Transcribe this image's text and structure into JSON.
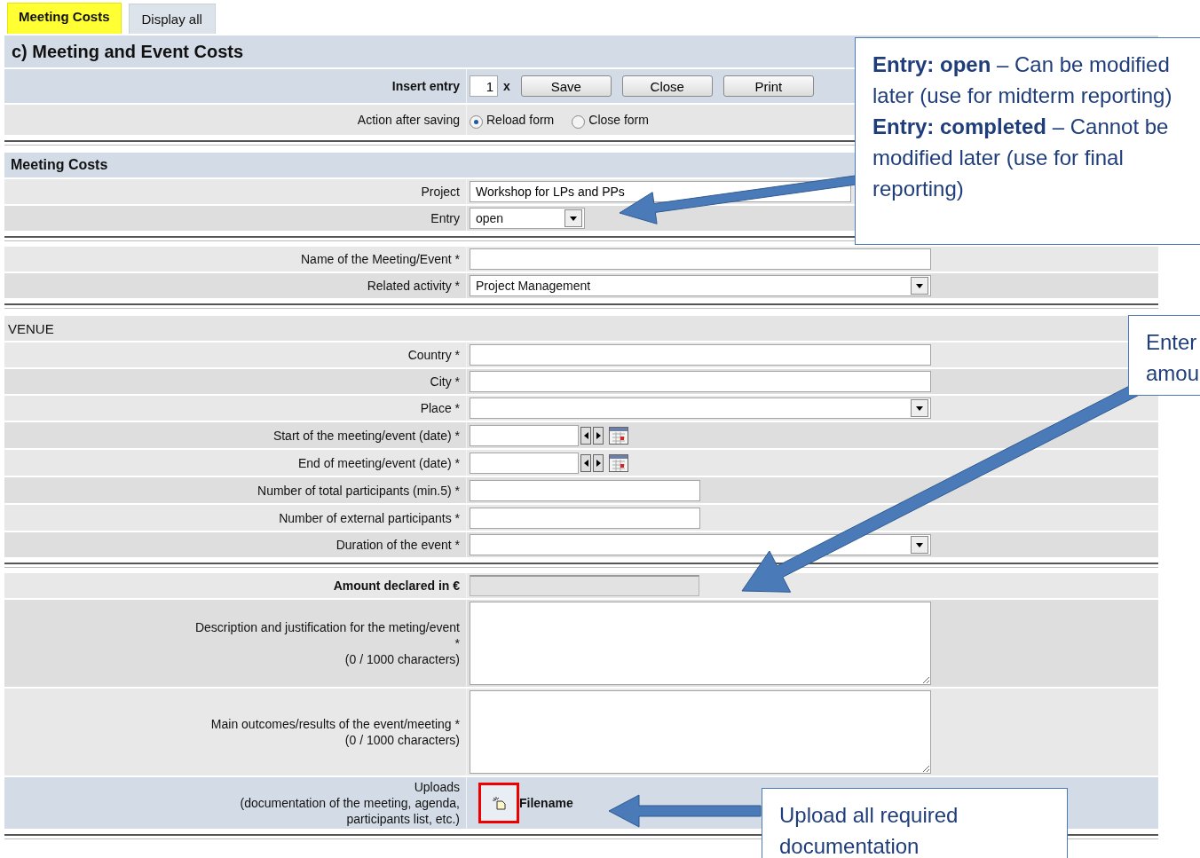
{
  "tabs": [
    {
      "label": "Meeting Costs",
      "selected": true
    },
    {
      "label": "Display all",
      "selected": false
    }
  ],
  "title": "c) Meeting and Event Costs",
  "toolbar": {
    "label": "Insert entry",
    "count": "1",
    "times": "x",
    "buttons": [
      "Save",
      "Close",
      "Print"
    ]
  },
  "after_saving": {
    "label": "Action after saving",
    "options": [
      {
        "label": "Reload form",
        "selected": true
      },
      {
        "label": "Close form",
        "selected": false
      }
    ]
  },
  "groups": [
    {
      "heading": {
        "text": "Meeting Costs",
        "kind": "band"
      },
      "rows": [
        {
          "kind": "text",
          "label": "Project",
          "value": "Workshop for LPs and PPs"
        },
        {
          "kind": "short-select",
          "label": "Entry",
          "value": "open"
        }
      ]
    },
    {
      "rows": [
        {
          "kind": "text",
          "label": "Name of the Meeting/Event *"
        },
        {
          "kind": "select",
          "label": "Related activity *",
          "value": "Project Management"
        }
      ]
    },
    {
      "heading": {
        "text": "VENUE",
        "kind": "plain"
      },
      "rows": [
        {
          "kind": "text",
          "label": "Country *"
        },
        {
          "kind": "text",
          "label": "City *"
        },
        {
          "kind": "select",
          "label": "Place *"
        },
        {
          "kind": "date",
          "label": "Start of the meeting/event (date) *"
        },
        {
          "kind": "date",
          "label": "End of meeting/event (date) *"
        },
        {
          "kind": "number",
          "label": "Number of total participants (min.5) *"
        },
        {
          "kind": "number",
          "label": "Number of external participants *"
        },
        {
          "kind": "select",
          "label": "Duration of the event *"
        }
      ]
    },
    {
      "rows": [
        {
          "kind": "amount",
          "label": "Amount declared in €"
        },
        {
          "kind": "textarea",
          "label": "Description and justification for the meting/event *",
          "note": "(0 / 1000 characters)"
        },
        {
          "kind": "textarea",
          "label": "Main outcomes/results of the event/meeting *",
          "note": "(0 / 1000 characters)"
        },
        {
          "kind": "upload",
          "label": "Uploads",
          "note": "(documentation of the meeting, agenda, participants list, etc.)",
          "column": "Filename"
        }
      ]
    }
  ],
  "callouts": [
    {
      "paragraphs": [
        "**Entry: open** – Can be modified later (use for midterm reporting)",
        "**Entry: completed** – Cannot be modified later (use for final reporting)"
      ]
    },
    {
      "paragraphs": [
        "Enter",
        "amou"
      ]
    },
    {
      "paragraphs": [
        "Upload all required documentation"
      ]
    }
  ]
}
